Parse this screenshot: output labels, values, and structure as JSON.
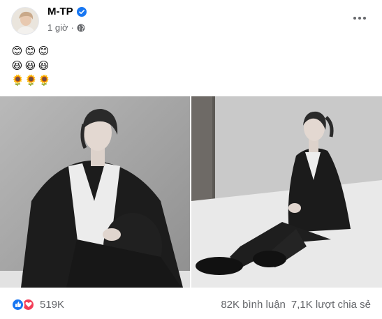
{
  "post": {
    "author": "M-TP",
    "time": "1 giờ",
    "separator": "·",
    "verified_icon": "verified-badge-icon",
    "privacy_icon": "globe-icon",
    "more_icon": "more-options-icon",
    "text_lines": [
      [
        "😊",
        "😊",
        "😊"
      ],
      [
        "😆",
        "😆",
        "😆"
      ],
      [
        "🌻",
        "🌻",
        "🌻"
      ]
    ]
  },
  "photos": [
    {
      "name": "photo-1",
      "subject": "man in black suit sitting against wall"
    },
    {
      "name": "photo-2",
      "subject": "man in black suit sitting on floor"
    }
  ],
  "stats": {
    "reaction_count": "519K",
    "comments": "82K bình luận",
    "shares": "7,1K lượt chia sẻ"
  },
  "colors": {
    "facebook_blue": "#1877f2",
    "love_red": "#f33e58",
    "secondary_text": "#65676b"
  }
}
